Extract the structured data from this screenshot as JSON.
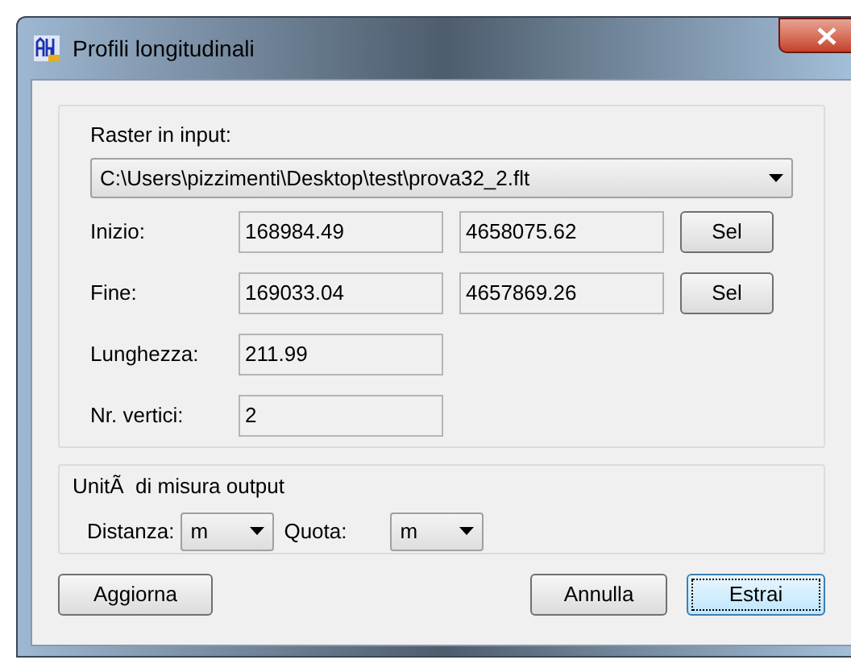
{
  "window": {
    "title": "Profili longitudinali"
  },
  "raster": {
    "label": "Raster in input:",
    "value": "C:\\Users\\pizzimenti\\Desktop\\test\\prova32_2.flt"
  },
  "rows": [
    {
      "label": "Inizio:",
      "values": [
        "168984.49",
        "4658075.62"
      ],
      "button": "Sel"
    },
    {
      "label": "Fine:",
      "values": [
        "169033.04",
        "4657869.26"
      ],
      "button": "Sel"
    },
    {
      "label": "Lunghezza:",
      "values": [
        "211.99"
      ]
    },
    {
      "label": "Nr. vertici:",
      "values": [
        "2"
      ]
    }
  ],
  "units": {
    "title": "UnitÃ  di misura output",
    "fields": [
      {
        "label": "Distanza:",
        "value": "m"
      },
      {
        "label": "Quota:",
        "value": "m"
      }
    ]
  },
  "buttons": [
    {
      "label": "Aggiorna",
      "focused": false
    },
    {
      "label": "Annulla",
      "focused": false
    },
    {
      "label": "Estrai",
      "focused": true
    }
  ]
}
